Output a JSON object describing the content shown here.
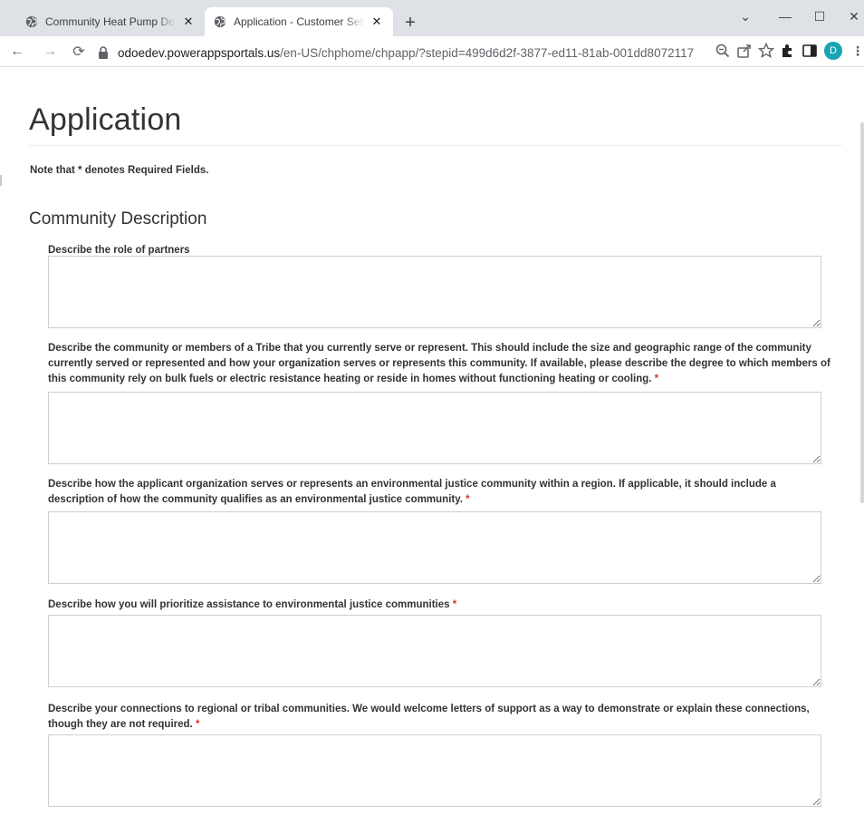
{
  "browser": {
    "tabs": [
      {
        "title": "Community Heat Pump Deploym",
        "close": "✕"
      },
      {
        "title": "Application - Customer Self-Servi",
        "close": "✕"
      }
    ],
    "new_tab": "+",
    "window_controls": {
      "minimize": "—",
      "maximize": "☐",
      "close": "✕",
      "dropdown": "⌄"
    },
    "nav": {
      "back": "←",
      "forward": "→",
      "reload": "⟳"
    },
    "url_host": "odoedev.powerappsportals.us",
    "url_path": "/en-US/chphome/chpapp/?stepid=499d6d2f-3877-ed11-81ab-001dd8072117",
    "profile_initial": "D",
    "toolbar_icons": [
      "zoom-icon",
      "share-icon",
      "star-icon",
      "extensions-icon",
      "sidepanel-icon"
    ]
  },
  "page": {
    "title": "Application",
    "note": "Note that * denotes Required Fields.",
    "section_title": "Community Description",
    "required_marker": "*",
    "fields": [
      {
        "label": "Describe the role of partners",
        "required": false,
        "value": ""
      },
      {
        "label": "Describe the community or members of a Tribe that you currently serve or represent. This should include the size and geographic range of the community currently served or represented and how your organization serves or represents this community. If available, please describe the degree to which members of this community rely on bulk fuels or electric resistance heating or reside in homes without functioning heating or cooling.",
        "required": true,
        "value": ""
      },
      {
        "label": "Describe how the applicant organization serves or represents an environmental justice community within a region. If applicable, it should include a description of how the community qualifies as an environmental justice community.",
        "required": true,
        "value": ""
      },
      {
        "label": "Describe how you will prioritize assistance to environmental justice communities",
        "required": true,
        "value": ""
      },
      {
        "label": "Describe your connections to regional or tribal communities. We would welcome letters of support as a way to demonstrate or explain these connections, though they are not required.",
        "required": true,
        "value": ""
      }
    ]
  },
  "colors": {
    "tabstrip": "#dee1e6",
    "required": "#e0312b",
    "profile": "#1aa3b2",
    "text": "#333333"
  }
}
